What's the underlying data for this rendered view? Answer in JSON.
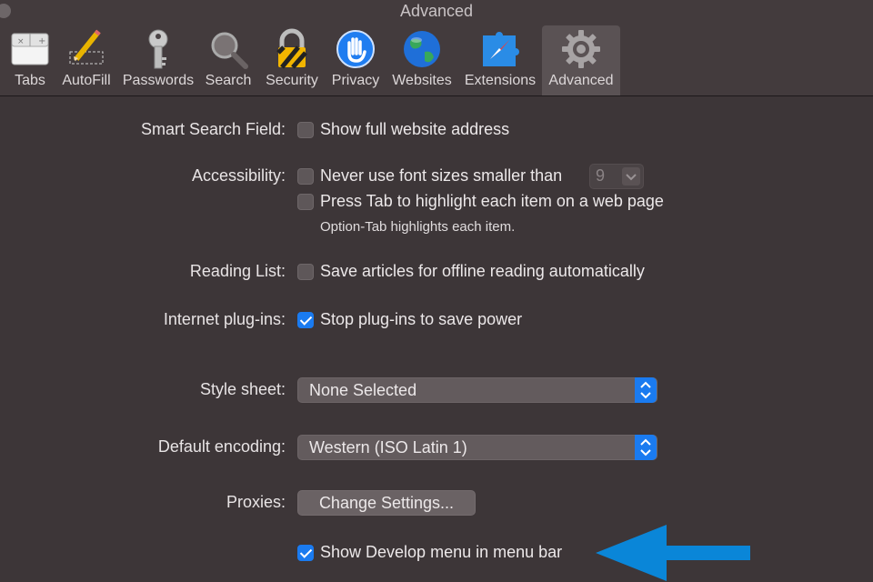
{
  "window": {
    "title": "Advanced"
  },
  "tabs": [
    {
      "label": "Tabs",
      "icon": "tabs-icon",
      "selected": false
    },
    {
      "label": "AutoFill",
      "icon": "autofill-icon",
      "selected": false
    },
    {
      "label": "Passwords",
      "icon": "key-icon",
      "selected": false
    },
    {
      "label": "Search",
      "icon": "magnifier-icon",
      "selected": false
    },
    {
      "label": "Security",
      "icon": "lock-icon",
      "selected": false
    },
    {
      "label": "Privacy",
      "icon": "hand-icon",
      "selected": false
    },
    {
      "label": "Websites",
      "icon": "globe-icon",
      "selected": false
    },
    {
      "label": "Extensions",
      "icon": "puzzle-compass-icon",
      "selected": false
    },
    {
      "label": "Advanced",
      "icon": "gear-icon",
      "selected": true
    }
  ],
  "settings": {
    "smart_search": {
      "label": "Smart Search Field:",
      "option": "Show full website address",
      "checked": false
    },
    "accessibility": {
      "label": "Accessibility:",
      "font_option": "Never use font sizes smaller than",
      "font_checked": false,
      "font_size_value": "9",
      "tab_option": "Press Tab to highlight each item on a web page",
      "tab_checked": false,
      "hint": "Option-Tab highlights each item."
    },
    "reading_list": {
      "label": "Reading List:",
      "option": "Save articles for offline reading automatically",
      "checked": false
    },
    "plugins": {
      "label": "Internet plug-ins:",
      "option": "Stop plug-ins to save power",
      "checked": true
    },
    "style_sheet": {
      "label": "Style sheet:",
      "value": "None Selected"
    },
    "encoding": {
      "label": "Default encoding:",
      "value": "Western (ISO Latin 1)"
    },
    "proxies": {
      "label": "Proxies:",
      "button": "Change Settings..."
    },
    "develop": {
      "option": "Show Develop menu in menu bar",
      "checked": true
    }
  },
  "colors": {
    "background": "#3d3638",
    "accent": "#1a7bf0",
    "annotation_arrow": "#0a86d8"
  }
}
